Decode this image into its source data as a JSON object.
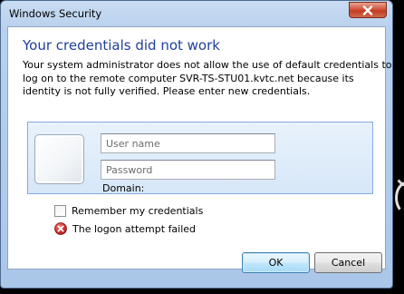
{
  "window": {
    "title": "Windows Security",
    "close_icon": "close-icon"
  },
  "dialog": {
    "heading": "Your credentials did not work",
    "message_lines": [
      "Your system administrator does not allow the use of default credentials to",
      "log on to the remote computer SVR-TS-STU01.kvtc.net because its",
      "identity is not fully verified. Please enter new credentials."
    ]
  },
  "credentials": {
    "tile_icon": "user-tile-icon",
    "username_placeholder": "User name",
    "username_value": "",
    "password_placeholder": "Password",
    "password_value": "",
    "domain_label": "Domain:"
  },
  "remember": {
    "label": "Remember my credentials",
    "checked": false
  },
  "error": {
    "icon": "error-icon",
    "text": "The logon attempt failed"
  },
  "buttons": {
    "ok_label": "OK",
    "cancel_label": "Cancel"
  },
  "colors": {
    "heading": "#1f3f9b",
    "window_frame": "#b9d1ee",
    "close_button": "#c33d22",
    "error_red": "#d32f2f"
  }
}
